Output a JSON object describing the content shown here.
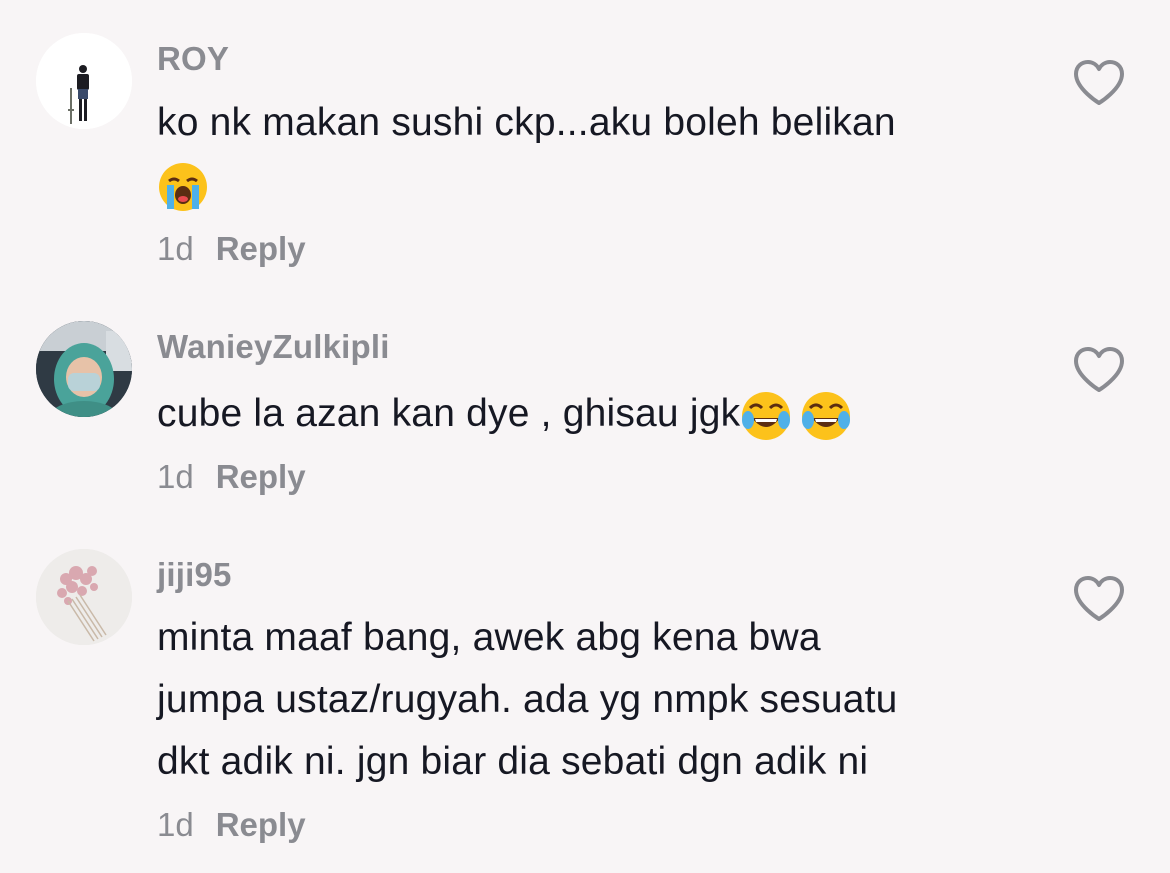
{
  "comments": [
    {
      "username": "ROY",
      "lines": [
        "ko nk makan sushi ckp...aku boleh belikan"
      ],
      "emojis": [
        "loudly-crying-face"
      ],
      "age": "1d",
      "reply_label": "Reply"
    },
    {
      "username": "WanieyZulkipli",
      "lines": [
        "cube la azan kan dye , ghisau jgk"
      ],
      "emojis": [
        "face-with-tears-of-joy",
        "face-with-tears-of-joy"
      ],
      "age": "1d",
      "reply_label": "Reply"
    },
    {
      "username": "jiji95",
      "lines": [
        "minta maaf bang, awek abg kena bwa",
        "jumpa ustaz/rugyah. ada yg nmpk sesuatu",
        "dkt adik ni. jgn biar dia sebati dgn adik ni"
      ],
      "emojis": [],
      "age": "1d",
      "reply_label": "Reply"
    }
  ],
  "icons": {
    "like": "heart-outline-icon"
  },
  "colors": {
    "background": "#f8f5f6",
    "username": "#8a8b91",
    "text": "#161823",
    "meta": "#8a8b91",
    "emoji_yellow": "#fcc21b",
    "emoji_tears": "#4fb0e8"
  }
}
